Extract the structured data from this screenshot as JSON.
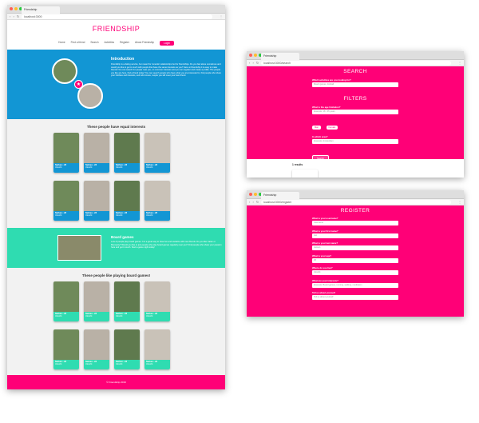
{
  "main": {
    "tab_title": "Friendship",
    "url": "localhost:3000",
    "logo": "FRIENDSHIP",
    "menu": [
      "Home",
      "Find a friend",
      "Search",
      "Activities",
      "Register",
      "About Friendship",
      "Login"
    ],
    "intro": {
      "heading": "Introduction",
      "text": "Friendship is a dating service, but meant for romantic relationships but for friendships. Do you feel alone sometimes and would you like to get in touch with people that have the same interests as you? Here at Friendship it is easy to make friends! You can search for people near you, on common interests and you can register and create a profile. The people you like are here, find a friend today! You can search people who have what you are interested in, find people who share your hobbies and interests, and who knows, maybe you will meet your best friend."
    },
    "equal_title": "These people have equal interests",
    "board": {
      "heading": "Board games",
      "text": "Lots of people play board games. It is a great way to have fun and socialize with new friends. Do you like Catan or Monopoly? Would you like to join people who play board games regularly near you? Find people who share your passion here and get in touch. Start a game night today!"
    },
    "board_title": "These people like playing board games!",
    "card_name": "Nathan • 28",
    "card_city": "Utrecht",
    "footer": "© Friendship 2019"
  },
  "search": {
    "tab_title": "Friendship",
    "url": "localhost:3000/search",
    "title": "SEARCH",
    "q_label": "Which activities are you looking for?",
    "q_placeholder": "Board games, football",
    "filters_title": "FILTERS",
    "age_label": "What is the age limitation?",
    "age_placeholder": "Example: 18 - 45 years",
    "chips": [
      "Man",
      "Female"
    ],
    "area_label": "In which area?",
    "area_placeholder": "Example: Amsterdam",
    "button": "Search",
    "results": "1 results"
  },
  "register": {
    "tab_title": "Friendship",
    "url": "localhost:3000/register",
    "title": "REGISTER",
    "fields": [
      {
        "label": "What is your username?",
        "placeholder": "Username"
      },
      {
        "label": "What is your first name?",
        "placeholder": "Jan"
      },
      {
        "label": "What is your last name?",
        "placeholder": "Jansen"
      },
      {
        "label": "What is your age?",
        "placeholder": "25"
      },
      {
        "label": "Where do you live?",
        "placeholder": "Utrecht"
      },
      {
        "label": "What are your interests?",
        "placeholder": "Example: Board games, running, walking, meditation"
      },
      {
        "label": "Tell us about yourself",
        "placeholder": "Tell us about yourself"
      }
    ]
  },
  "colors": {
    "brand": "#ff0077",
    "blue": "#1296d4",
    "teal": "#2fdcb1"
  }
}
